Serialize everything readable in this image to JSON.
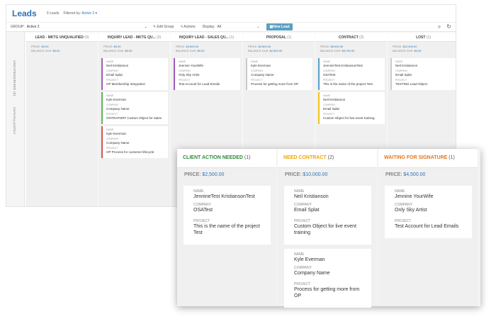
{
  "header": {
    "title": "Leads",
    "count": "0 Leads",
    "filter_label": "Filtered by:",
    "filter_value": "Active 2"
  },
  "toolbar": {
    "group_label": "GROUP:",
    "group_value": "Active 2",
    "edit_group": "Edit Group",
    "actions": "Actions",
    "display_label": "Display:",
    "display_value": "All",
    "new_lead": "New Lead",
    "search_icon": "search-icon",
    "refresh_icon": "refresh-icon"
  },
  "sidebar": {
    "label1": "UNCATEGORIZED (0)",
    "label2": "Marketing qualified"
  },
  "colors": {
    "brand": "#2f73b4",
    "client_action": "#2e8b3d",
    "need_contract": "#f4a300",
    "waiting": "#e8751a"
  },
  "columns": [
    {
      "title": "LEAD - MKTG UNQUALIFIED",
      "count": "(0)",
      "price": "$0.00",
      "balance": "$0.00",
      "cards": []
    },
    {
      "title": "INQUIRY LEAD - MKTG QU...",
      "count": "(3)",
      "price": "$0.00",
      "balance": "$0.00",
      "cards": [
        {
          "name": "Neil Kristianson",
          "company": "Email Splat",
          "project": "OP Membership Integration",
          "accent": "#a25bbf"
        },
        {
          "name": "Kyle Everman",
          "company": "Company Name",
          "project": "ONTRAPORT Custom Object for Sales",
          "accent": "#5cb85c"
        },
        {
          "name": "Kyle Everman",
          "company": "Company Name",
          "project": "OP Process for customer lifecycle",
          "accent": "#d9534f"
        }
      ]
    },
    {
      "title": "INQUIRY LEAD - SALES QU...",
      "count": "(1)",
      "price": "$4,500.00",
      "balance": "$0.00",
      "cards": [
        {
          "name": "Jennine YourWife",
          "company": "Only Sky Artist",
          "project": "Test Account for Lead Emails",
          "accent": "#a25bbf"
        }
      ]
    },
    {
      "title": "PROPOSAL",
      "count": "(1)",
      "price": "$2,500.00",
      "balance": "$2,500.00",
      "cards": [
        {
          "name": "Kyle Everman",
          "company": "Company Name",
          "project": "Process for getting more from OP",
          "accent": "#cccccc"
        }
      ]
    },
    {
      "title": "CONTRACT",
      "count": "(2)",
      "price": "$5,000.00",
      "balance": "$5,700.00",
      "cards": [
        {
          "name": "JennineTest KristiansonTest",
          "company": "OSATest",
          "project": "This is the name of the project Test",
          "accent": "#5aa0c4"
        },
        {
          "name": "Neil Kristianson",
          "company": "Email Splat",
          "project": "Custom Object for live event training",
          "accent": "#f0c419"
        }
      ]
    },
    {
      "title": "LOST",
      "count": "(1)",
      "price": "$12,000.00",
      "balance": "$0.00",
      "cards": [
        {
          "name": "Neil Kristianson",
          "company": "Email Splat",
          "project": "TESTING Lead Object",
          "accent": "#cccccc"
        }
      ]
    }
  ],
  "field_labels": {
    "name": "NAME",
    "company": "COMPANY",
    "project": "PROJECT",
    "price": "PRICE:",
    "balance": "BALANCE DUE:"
  },
  "zoom": {
    "field_labels": {
      "name": "NAME",
      "company": "COMPANY",
      "project": "PROJECT",
      "price": "PRICE:"
    },
    "columns": [
      {
        "title": "CLIENT ACTION NEEDED",
        "count": "(1)",
        "price": "$2,500.00",
        "cards": [
          {
            "name": "JennineTest KristiansonTest",
            "company": "OSATest",
            "project": "This is the name of the project Test"
          }
        ]
      },
      {
        "title": "NEED CONTRACT",
        "count": "(2)",
        "price": "$10,000.00",
        "cards": [
          {
            "name": "Neil Kristianson",
            "company": "Email Splat",
            "project": "Custom Object for live event training"
          },
          {
            "name": "Kyle Everman",
            "company": "Company Name",
            "project": "Process for getting more from OP"
          }
        ]
      },
      {
        "title": "WAITING FOR SIGNATURE",
        "count": "(1)",
        "price": "$4,500.00",
        "cards": [
          {
            "name": "Jennine YourWife",
            "company": "Only Sky Artist",
            "project": "Test Account for Lead Emails"
          }
        ]
      }
    ]
  }
}
